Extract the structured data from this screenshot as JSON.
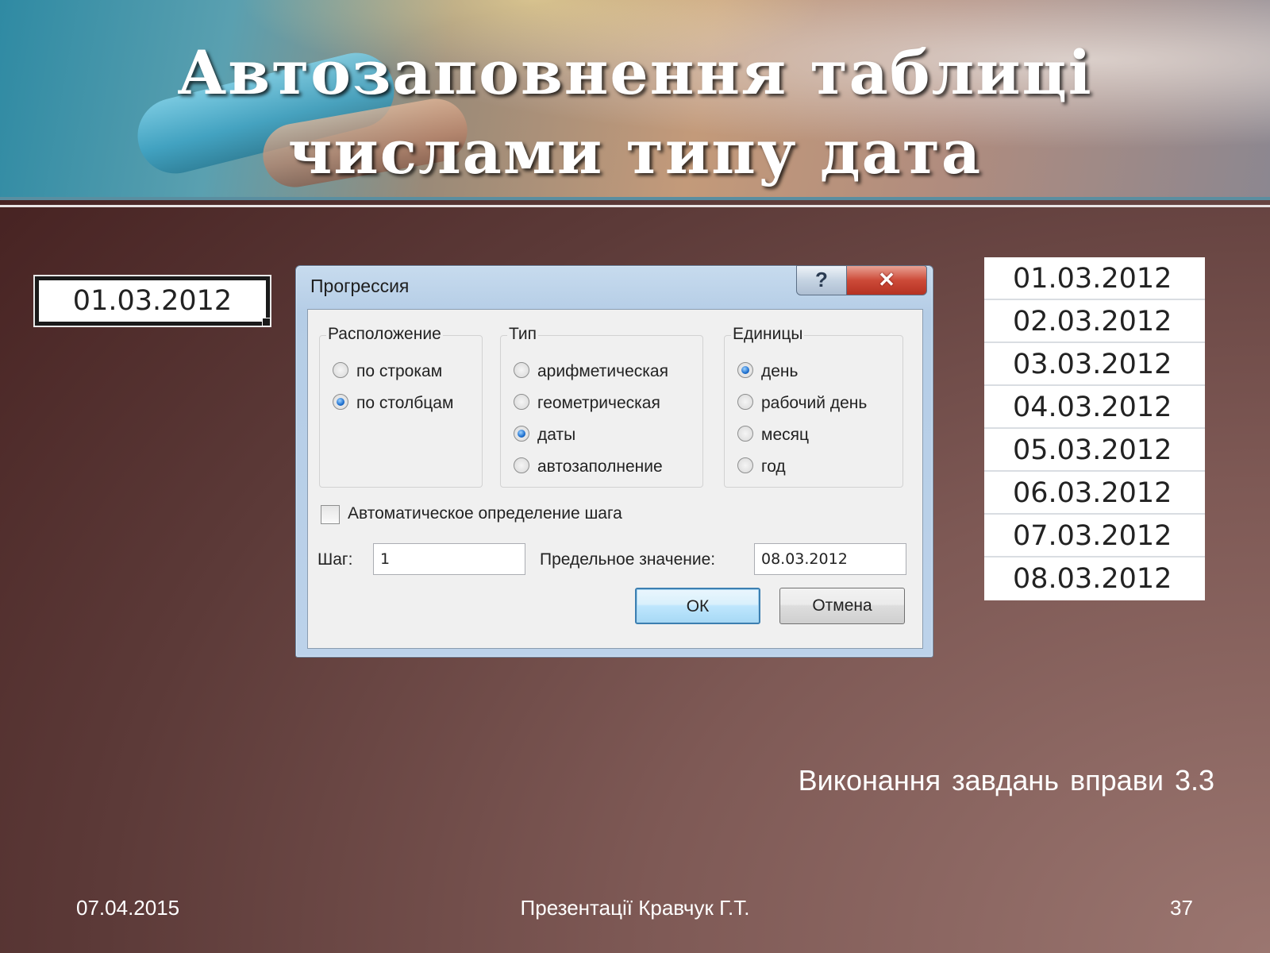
{
  "slide": {
    "title_line1": "Автозаповнення таблиці",
    "title_line2": "числами типу дата",
    "caption": "Виконання завдань вправи 3.3"
  },
  "start_cell": {
    "value": "01.03.2012"
  },
  "result_column": {
    "values": [
      "01.03.2012",
      "02.03.2012",
      "03.03.2012",
      "04.03.2012",
      "05.03.2012",
      "06.03.2012",
      "07.03.2012",
      "08.03.2012"
    ]
  },
  "dialog": {
    "title": "Прогрессия",
    "help_label": "?",
    "close_label": "✕",
    "location": {
      "legend": "Расположение",
      "options": [
        "по строкам",
        "по столбцам"
      ],
      "selected": "по столбцам"
    },
    "type": {
      "legend": "Тип",
      "options": [
        "арифметическая",
        "геометрическая",
        "даты",
        "автозаполнение"
      ],
      "selected": "даты"
    },
    "units": {
      "legend": "Единицы",
      "options": [
        "день",
        "рабочий день",
        "месяц",
        "год"
      ],
      "selected": "день"
    },
    "auto_step_label": "Автоматическое определение шага",
    "auto_step_checked": false,
    "step_label": "Шаг:",
    "step_value": "1",
    "limit_label": "Предельное значение:",
    "limit_value": "08.03.2012",
    "ok_label": "ОК",
    "cancel_label": "Отмена"
  },
  "footer": {
    "date": "07.04.2015",
    "author": "Презентації Кравчук Г.Т.",
    "page": "37"
  }
}
